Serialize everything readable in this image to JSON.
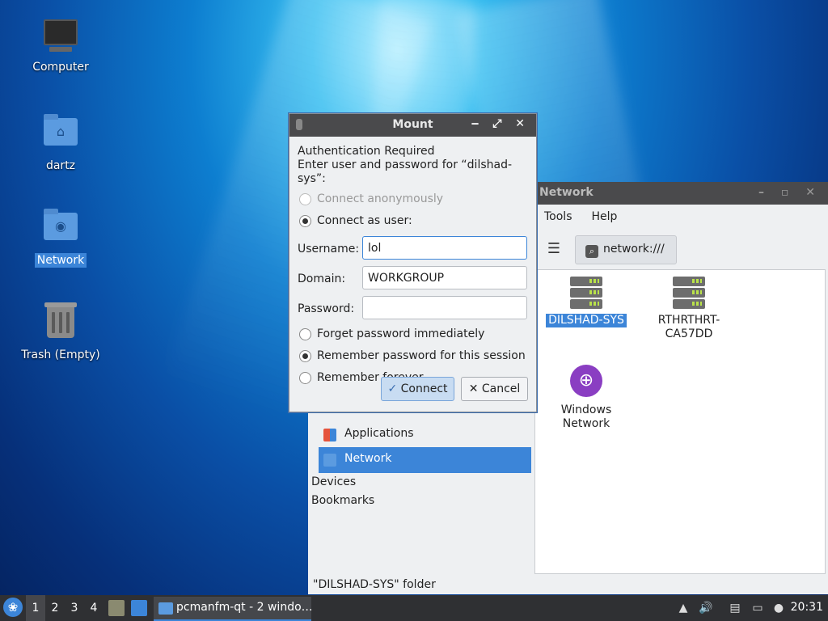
{
  "desktop": {
    "icons": [
      {
        "label": "Computer",
        "icon": "computer-icon"
      },
      {
        "label": "dartz",
        "icon": "home-folder-icon"
      },
      {
        "label": "Network",
        "icon": "network-folder-icon"
      },
      {
        "label": "Trash (Empty)",
        "icon": "trash-icon"
      }
    ]
  },
  "file_manager": {
    "title": "Network",
    "window_controls": "– ▫ ✕",
    "menu": [
      "Tools",
      "Help"
    ],
    "path": "network:///",
    "items": [
      {
        "label": "DILSHAD-SYS",
        "icon": "server-icon"
      },
      {
        "label": "RTHRTHRT-CA57DD",
        "line1": "RTHRTHRT-",
        "line2": "CA57DD",
        "icon": "server-icon"
      },
      {
        "label": "Windows Network",
        "line1": "Windows",
        "line2": "Network",
        "icon": "globe-icon"
      }
    ],
    "sidebar": {
      "places": [
        {
          "label": "Applications",
          "icon": "applications-icon"
        },
        {
          "label": "Network",
          "icon": "network-icon"
        }
      ],
      "sections": [
        "Devices",
        "Bookmarks"
      ]
    },
    "status": "\"DILSHAD-SYS\" folder"
  },
  "mount_dialog": {
    "title": "Mount",
    "heading": "Authentication Required",
    "prompt": "Enter user and password for “dilshad-sys”:",
    "connect_anonymously": "Connect anonymously",
    "connect_as_user": "Connect as user:",
    "username_label": "Username:",
    "username_value": "lol",
    "domain_label": "Domain:",
    "domain_value": "WORKGROUP",
    "password_label": "Password:",
    "password_value": "",
    "forget_password": "Forget password immediately",
    "remember_session": "Remember password for this session",
    "remember_forever": "Remember forever",
    "connect_button": "Connect",
    "cancel_button": "Cancel",
    "selected_login_mode": "Connect as user:",
    "selected_password_mode": "Remember password for this session"
  },
  "taskbar": {
    "workspaces": [
      "1",
      "2",
      "3",
      "4"
    ],
    "active_workspace": "1",
    "task_label": "pcmanfm-qt - 2 windo…",
    "clock": "20:31"
  },
  "colors": {
    "accent": "#3c85d8",
    "titlebar": "#4a4a4c",
    "taskbar": "#2f3033"
  }
}
